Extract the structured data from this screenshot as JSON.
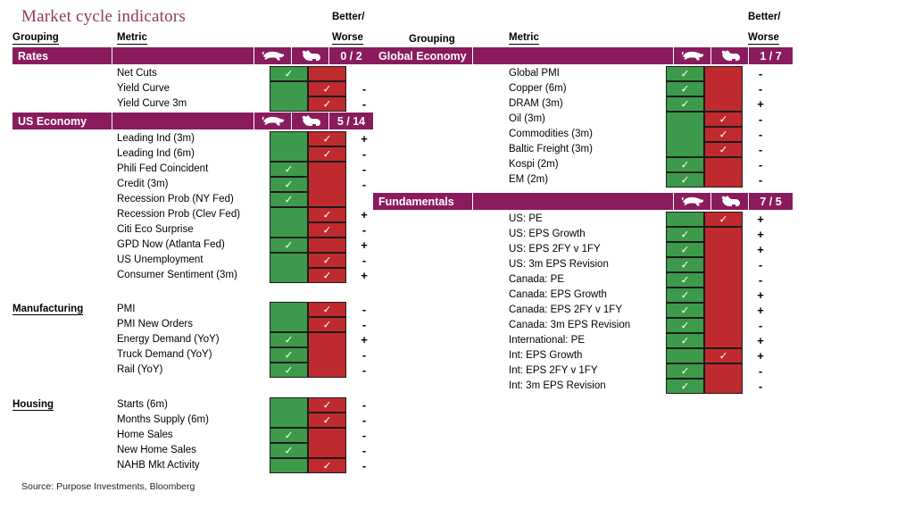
{
  "title": "Market cycle indicators",
  "source": "Source: Purpose Investments, Bloomberg",
  "colors": {
    "header_bar": "#8a1b5c",
    "title_text": "#8f3a62",
    "bull_green": "#3d9a4b",
    "bear_red": "#bf2a2f"
  },
  "headers": {
    "grouping": "Grouping",
    "metric": "Metric",
    "better": "Better/",
    "worse": "Worse"
  },
  "icons": {
    "bull": "bull-icon",
    "bear": "bear-icon"
  },
  "left": {
    "groups": [
      {
        "name": "Rates",
        "score": "0 / 2",
        "style": "bar",
        "rows": [
          {
            "metric": "Net Cuts",
            "signal": "bull",
            "delta": ""
          },
          {
            "metric": "Yield Curve",
            "signal": "bear",
            "delta": "-"
          },
          {
            "metric": "Yield Curve 3m",
            "signal": "bear",
            "delta": "-"
          }
        ]
      },
      {
        "name": "US Economy",
        "score": "5 / 14",
        "style": "bar",
        "rows": [
          {
            "metric": "Leading Ind (3m)",
            "signal": "bear",
            "delta": "+"
          },
          {
            "metric": "Leading Ind (6m)",
            "signal": "bear",
            "delta": "-"
          },
          {
            "metric": "Phili Fed Coincident",
            "signal": "bull",
            "delta": "-"
          },
          {
            "metric": "Credit (3m)",
            "signal": "bull",
            "delta": "-"
          },
          {
            "metric": "Recession Prob (NY Fed)",
            "signal": "bull",
            "delta": ""
          },
          {
            "metric": "Recession Prob (Clev Fed)",
            "signal": "bear",
            "delta": "+"
          },
          {
            "metric": "Citi Eco Surprise",
            "signal": "bear",
            "delta": "-"
          },
          {
            "metric": "GPD Now (Atlanta Fed)",
            "signal": "bull",
            "delta": "+"
          },
          {
            "metric": "US Unemployment",
            "signal": "bear",
            "delta": "-"
          },
          {
            "metric": "Consumer Sentiment (3m)",
            "signal": "bear",
            "delta": "+"
          }
        ]
      },
      {
        "name": "Manufacturing",
        "score": "",
        "style": "plain",
        "rows": [
          {
            "metric": "PMI",
            "signal": "bear",
            "delta": "-"
          },
          {
            "metric": "PMI New Orders",
            "signal": "bear",
            "delta": "-"
          },
          {
            "metric": "Energy Demand (YoY)",
            "signal": "bull",
            "delta": "+"
          },
          {
            "metric": "Truck Demand (YoY)",
            "signal": "bull",
            "delta": "-"
          },
          {
            "metric": "Rail (YoY)",
            "signal": "bull",
            "delta": "-"
          }
        ]
      },
      {
        "name": "Housing",
        "score": "",
        "style": "plain",
        "rows": [
          {
            "metric": "Starts (6m)",
            "signal": "bear",
            "delta": "-"
          },
          {
            "metric": "Months Supply (6m)",
            "signal": "bear",
            "delta": "-"
          },
          {
            "metric": "Home Sales",
            "signal": "bull",
            "delta": "-"
          },
          {
            "metric": "New Home Sales",
            "signal": "bull",
            "delta": "-"
          },
          {
            "metric": "NAHB Mkt Activity",
            "signal": "bear",
            "delta": "-"
          }
        ]
      }
    ]
  },
  "right": {
    "groups": [
      {
        "name": "Global Economy",
        "score": "1 / 7",
        "style": "bar",
        "rows": [
          {
            "metric": "Global PMI",
            "signal": "bull",
            "delta": "-"
          },
          {
            "metric": "Copper (6m)",
            "signal": "bull",
            "delta": "-"
          },
          {
            "metric": "DRAM (3m)",
            "signal": "bull",
            "delta": "+"
          },
          {
            "metric": "Oil (3m)",
            "signal": "bear",
            "delta": "-"
          },
          {
            "metric": "Commodities (3m)",
            "signal": "bear",
            "delta": "-"
          },
          {
            "metric": "Baltic Freight (3m)",
            "signal": "bear",
            "delta": "-"
          },
          {
            "metric": "Kospi (2m)",
            "signal": "bull",
            "delta": "-"
          },
          {
            "metric": "EM (2m)",
            "signal": "bull",
            "delta": "-"
          }
        ]
      },
      {
        "name": "Fundamentals",
        "score": "7 / 5",
        "style": "bar",
        "rows": [
          {
            "metric": "US: PE",
            "signal": "bear",
            "delta": "+"
          },
          {
            "metric": "US: EPS Growth",
            "signal": "bull",
            "delta": "+"
          },
          {
            "metric": "US: EPS 2FY v 1FY",
            "signal": "bull",
            "delta": "+"
          },
          {
            "metric": "US: 3m EPS Revision",
            "signal": "bull",
            "delta": "-"
          },
          {
            "metric": "Canada: PE",
            "signal": "bull",
            "delta": "-"
          },
          {
            "metric": "Canada: EPS Growth",
            "signal": "bull",
            "delta": "+"
          },
          {
            "metric": "Canada: EPS 2FY v 1FY",
            "signal": "bull",
            "delta": "+"
          },
          {
            "metric": "Canada: 3m EPS Revision",
            "signal": "bull",
            "delta": "-"
          },
          {
            "metric": "International: PE",
            "signal": "bull",
            "delta": "+"
          },
          {
            "metric": "Int: EPS Growth",
            "signal": "bear",
            "delta": "+"
          },
          {
            "metric": "Int: EPS 2FY v 1FY",
            "signal": "bull",
            "delta": "-"
          },
          {
            "metric": "Int: 3m EPS Revision",
            "signal": "bull",
            "delta": "-"
          }
        ]
      }
    ]
  }
}
